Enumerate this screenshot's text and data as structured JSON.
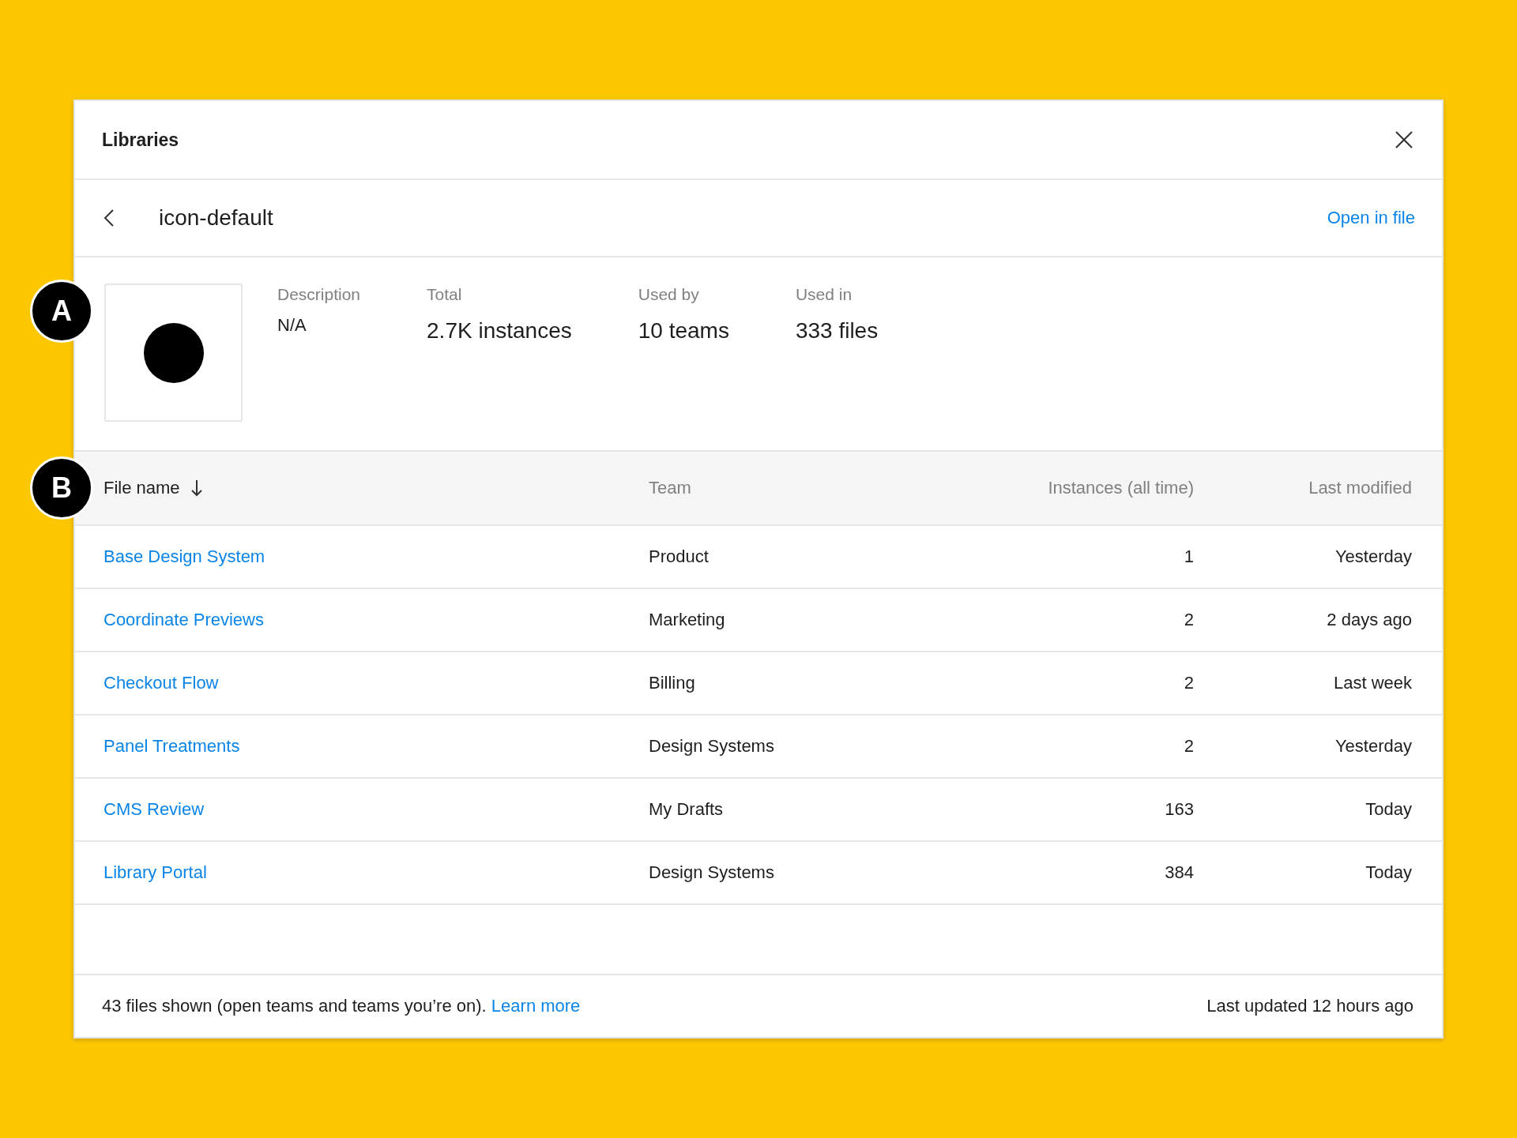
{
  "dialog": {
    "title": "Libraries"
  },
  "header": {
    "name": "icon-default",
    "link": "Open in file"
  },
  "info": {
    "description": {
      "label": "Description",
      "value": "N/A"
    },
    "stats": [
      {
        "label": "Total",
        "value": "2.7K instances"
      },
      {
        "label": "Used by",
        "value": "10 teams"
      },
      {
        "label": "Used in",
        "value": "333 files"
      }
    ]
  },
  "table": {
    "columns": [
      {
        "label": "File name",
        "sorted": true
      },
      {
        "label": "Team",
        "sorted": false
      },
      {
        "label": "Instances (all time)",
        "sorted": false
      },
      {
        "label": "Last modified",
        "sorted": false
      }
    ],
    "rows": [
      {
        "file": "Base Design System",
        "team": "Product",
        "instances": "1",
        "modified": "Yesterday"
      },
      {
        "file": "Coordinate Previews",
        "team": "Marketing",
        "instances": "2",
        "modified": "2 days ago"
      },
      {
        "file": "Checkout Flow",
        "team": "Billing",
        "instances": "2",
        "modified": "Last week"
      },
      {
        "file": "Panel Treatments",
        "team": "Design Systems",
        "instances": "2",
        "modified": "Yesterday"
      },
      {
        "file": "CMS Review",
        "team": "My Drafts",
        "instances": "163",
        "modified": "Today"
      },
      {
        "file": "Library Portal",
        "team": "Design Systems",
        "instances": "384",
        "modified": "Today"
      }
    ]
  },
  "footer": {
    "text": "43 files shown (open teams and teams you’re on).",
    "link": "Learn more",
    "updated": "Last updated 12 hours ago"
  },
  "callouts": [
    "A",
    "B"
  ]
}
